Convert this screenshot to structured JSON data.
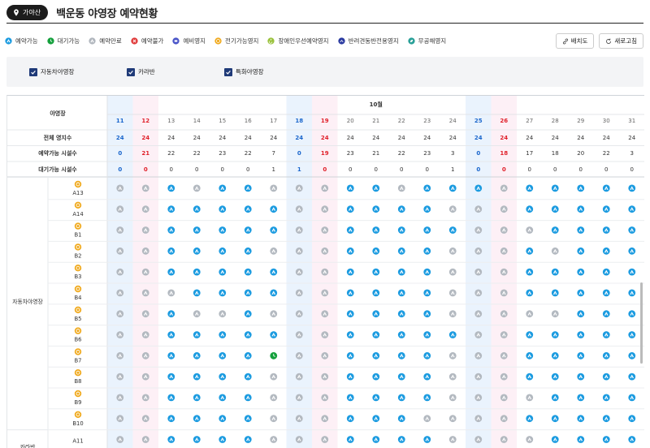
{
  "header": {
    "location_label": "가야산",
    "title": "백운동 야영장 예약현황"
  },
  "legend": [
    {
      "label": "예약가능",
      "icon": "tent-available-icon",
      "color": "#1b9be0"
    },
    {
      "label": "대기가능",
      "icon": "clock-waitlist-icon",
      "color": "#14a03c"
    },
    {
      "label": "예약만료",
      "icon": "tent-closed-icon",
      "color": "#b0b6bd"
    },
    {
      "label": "예약불가",
      "icon": "x-unavailable-icon",
      "color": "#e03a3a"
    },
    {
      "label": "예비영지",
      "icon": "reserve-icon",
      "color": "#4a55c8"
    },
    {
      "label": "전기가능영지",
      "icon": "electric-icon",
      "color": "#f0a91c"
    },
    {
      "label": "장애인우선예약영지",
      "icon": "accessible-icon",
      "color": "#9ac23c"
    },
    {
      "label": "반려견동반전용영지",
      "icon": "pet-icon",
      "color": "#2a3aa0"
    },
    {
      "label": "무공해영지",
      "icon": "eco-icon",
      "color": "#2aa098"
    }
  ],
  "buttons": {
    "layout": "배치도",
    "refresh": "새로고침"
  },
  "filters": [
    {
      "label": "자동차야영장",
      "checked": true
    },
    {
      "label": "카라반",
      "checked": true
    },
    {
      "label": "특화야영장",
      "checked": true
    }
  ],
  "table": {
    "corner_label": "야영장",
    "month_label": "10월",
    "days": [
      {
        "d": "11",
        "type": "sat",
        "total": "24",
        "avail": "0",
        "wait": "0"
      },
      {
        "d": "12",
        "type": "sun",
        "total": "24",
        "avail": "21",
        "wait": "0"
      },
      {
        "d": "13",
        "type": "wd",
        "total": "24",
        "avail": "22",
        "wait": "0"
      },
      {
        "d": "14",
        "type": "wd",
        "total": "24",
        "avail": "22",
        "wait": "0"
      },
      {
        "d": "15",
        "type": "wd",
        "total": "24",
        "avail": "23",
        "wait": "0"
      },
      {
        "d": "16",
        "type": "wd",
        "total": "24",
        "avail": "22",
        "wait": "0"
      },
      {
        "d": "17",
        "type": "wd",
        "total": "24",
        "avail": "7",
        "wait": "1"
      },
      {
        "d": "18",
        "type": "sat",
        "total": "24",
        "avail": "0",
        "wait": "1"
      },
      {
        "d": "19",
        "type": "sun",
        "total": "24",
        "avail": "19",
        "wait": "0"
      },
      {
        "d": "20",
        "type": "wd",
        "total": "24",
        "avail": "23",
        "wait": "0"
      },
      {
        "d": "21",
        "type": "wd",
        "total": "24",
        "avail": "21",
        "wait": "0"
      },
      {
        "d": "22",
        "type": "wd",
        "total": "24",
        "avail": "22",
        "wait": "0"
      },
      {
        "d": "23",
        "type": "wd",
        "total": "24",
        "avail": "23",
        "wait": "0"
      },
      {
        "d": "24",
        "type": "wd",
        "total": "24",
        "avail": "3",
        "wait": "1"
      },
      {
        "d": "25",
        "type": "sat",
        "total": "24",
        "avail": "0",
        "wait": "0"
      },
      {
        "d": "26",
        "type": "sun",
        "total": "24",
        "avail": "18",
        "wait": "0"
      },
      {
        "d": "27",
        "type": "wd",
        "total": "24",
        "avail": "17",
        "wait": "0"
      },
      {
        "d": "28",
        "type": "wd",
        "total": "24",
        "avail": "18",
        "wait": "0"
      },
      {
        "d": "29",
        "type": "wd",
        "total": "24",
        "avail": "20",
        "wait": "0"
      },
      {
        "d": "30",
        "type": "wd",
        "total": "24",
        "avail": "22",
        "wait": "0"
      },
      {
        "d": "31",
        "type": "wd",
        "total": "24",
        "avail": "3",
        "wait": "0"
      }
    ],
    "summary_labels": [
      "전체 영지수",
      "예약가능 시설수",
      "대기가능 시설수"
    ],
    "section_label": "자동차야영장",
    "next_section_label": "카라반",
    "sites": [
      {
        "name": "A13",
        "electric": true,
        "cells": "CCACAACCCAACAAACAAAAA"
      },
      {
        "name": "A14",
        "electric": true,
        "cells": "CCAAAAACCAAAACCCAAAAA"
      },
      {
        "name": "B1",
        "electric": true,
        "cells": "CCAAAAACCAAAAACCCAAAA"
      },
      {
        "name": "B2",
        "electric": true,
        "cells": "CCAAAACCCAAAACCCACAAA"
      },
      {
        "name": "B3",
        "electric": true,
        "cells": "CCAAAAACCAAAACCCAAAAA"
      },
      {
        "name": "B4",
        "electric": true,
        "cells": "CCCAAAACCAAAACCCAAAAA"
      },
      {
        "name": "B5",
        "electric": true,
        "cells": "CCACCACCCAAAACCCCCAAA"
      },
      {
        "name": "B6",
        "electric": true,
        "cells": "CCAAAAACCAAAAACCAAAAA"
      },
      {
        "name": "B7",
        "electric": true,
        "cells": "CCAAAAWCCAAAACCCAAAAA"
      },
      {
        "name": "B8",
        "electric": true,
        "cells": "CCAAAACCCAAAACCCAAAAA"
      },
      {
        "name": "B9",
        "electric": true,
        "cells": "CCAAAACCCAAAACCCCAAAA"
      },
      {
        "name": "B10",
        "electric": true,
        "cells": "CCAAAACCCAAACCCCAAAAA"
      },
      {
        "name": "A11",
        "electric": false,
        "cells": "CCAAAACCCAAAACCCCAAAA"
      }
    ]
  },
  "colors": {
    "available": "#1b9be0",
    "closed": "#b3b9c0",
    "waitlist": "#14a03c",
    "electric": "#f0a91c",
    "saturday": "#1a66cc",
    "sunday": "#e0202a",
    "saturday_bg": "#eaf3fd",
    "sunday_bg": "#fdf0f6"
  }
}
